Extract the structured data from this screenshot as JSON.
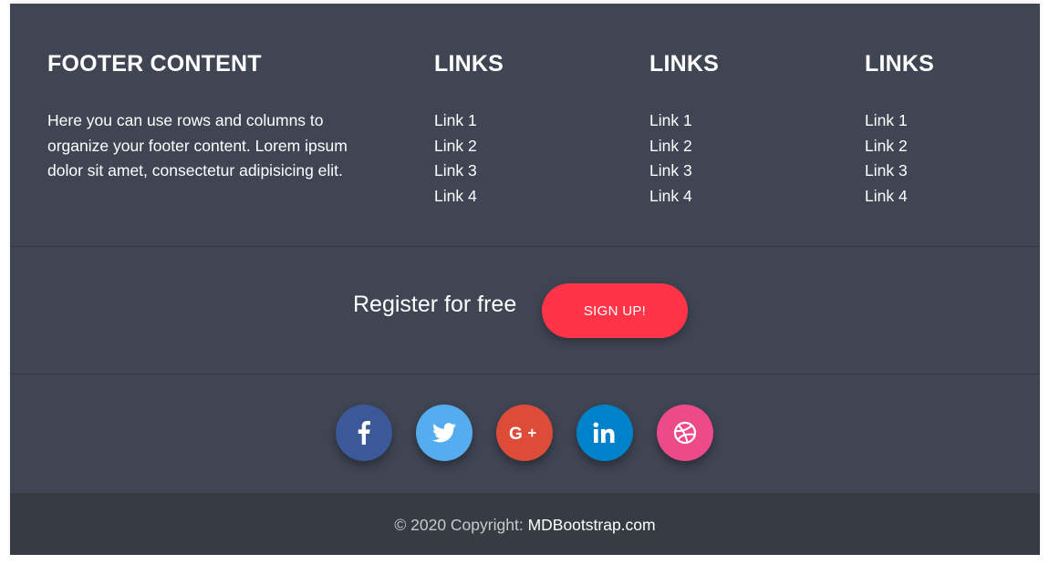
{
  "footer": {
    "about": {
      "title": "FOOTER CONTENT",
      "text": "Here you can use rows and columns to organize your footer content. Lorem ipsum dolor sit amet, consectetur adipisicing elit."
    },
    "link_columns": [
      {
        "title": "LINKS",
        "links": [
          "Link 1",
          "Link 2",
          "Link 3",
          "Link 4"
        ]
      },
      {
        "title": "LINKS",
        "links": [
          "Link 1",
          "Link 2",
          "Link 3",
          "Link 4"
        ]
      },
      {
        "title": "LINKS",
        "links": [
          "Link 1",
          "Link 2",
          "Link 3",
          "Link 4"
        ]
      }
    ],
    "register": {
      "label": "Register for free",
      "button_label": "SIGN UP!",
      "button_color": "#ff3547"
    },
    "social": [
      {
        "icon": "facebook-icon",
        "color": "#3b5998"
      },
      {
        "icon": "twitter-icon",
        "color": "#55acee"
      },
      {
        "icon": "google-plus-icon",
        "color": "#dd4b39"
      },
      {
        "icon": "linkedin-icon",
        "color": "#0082ca"
      },
      {
        "icon": "dribbble-icon",
        "color": "#ec4a89"
      }
    ],
    "copyright": {
      "prefix": "© 2020 Copyright:",
      "link_text": "MDBootstrap.com"
    },
    "colors": {
      "background": "#3f4553",
      "bottom_bar": "#373b44",
      "text": "#ffffff"
    }
  }
}
